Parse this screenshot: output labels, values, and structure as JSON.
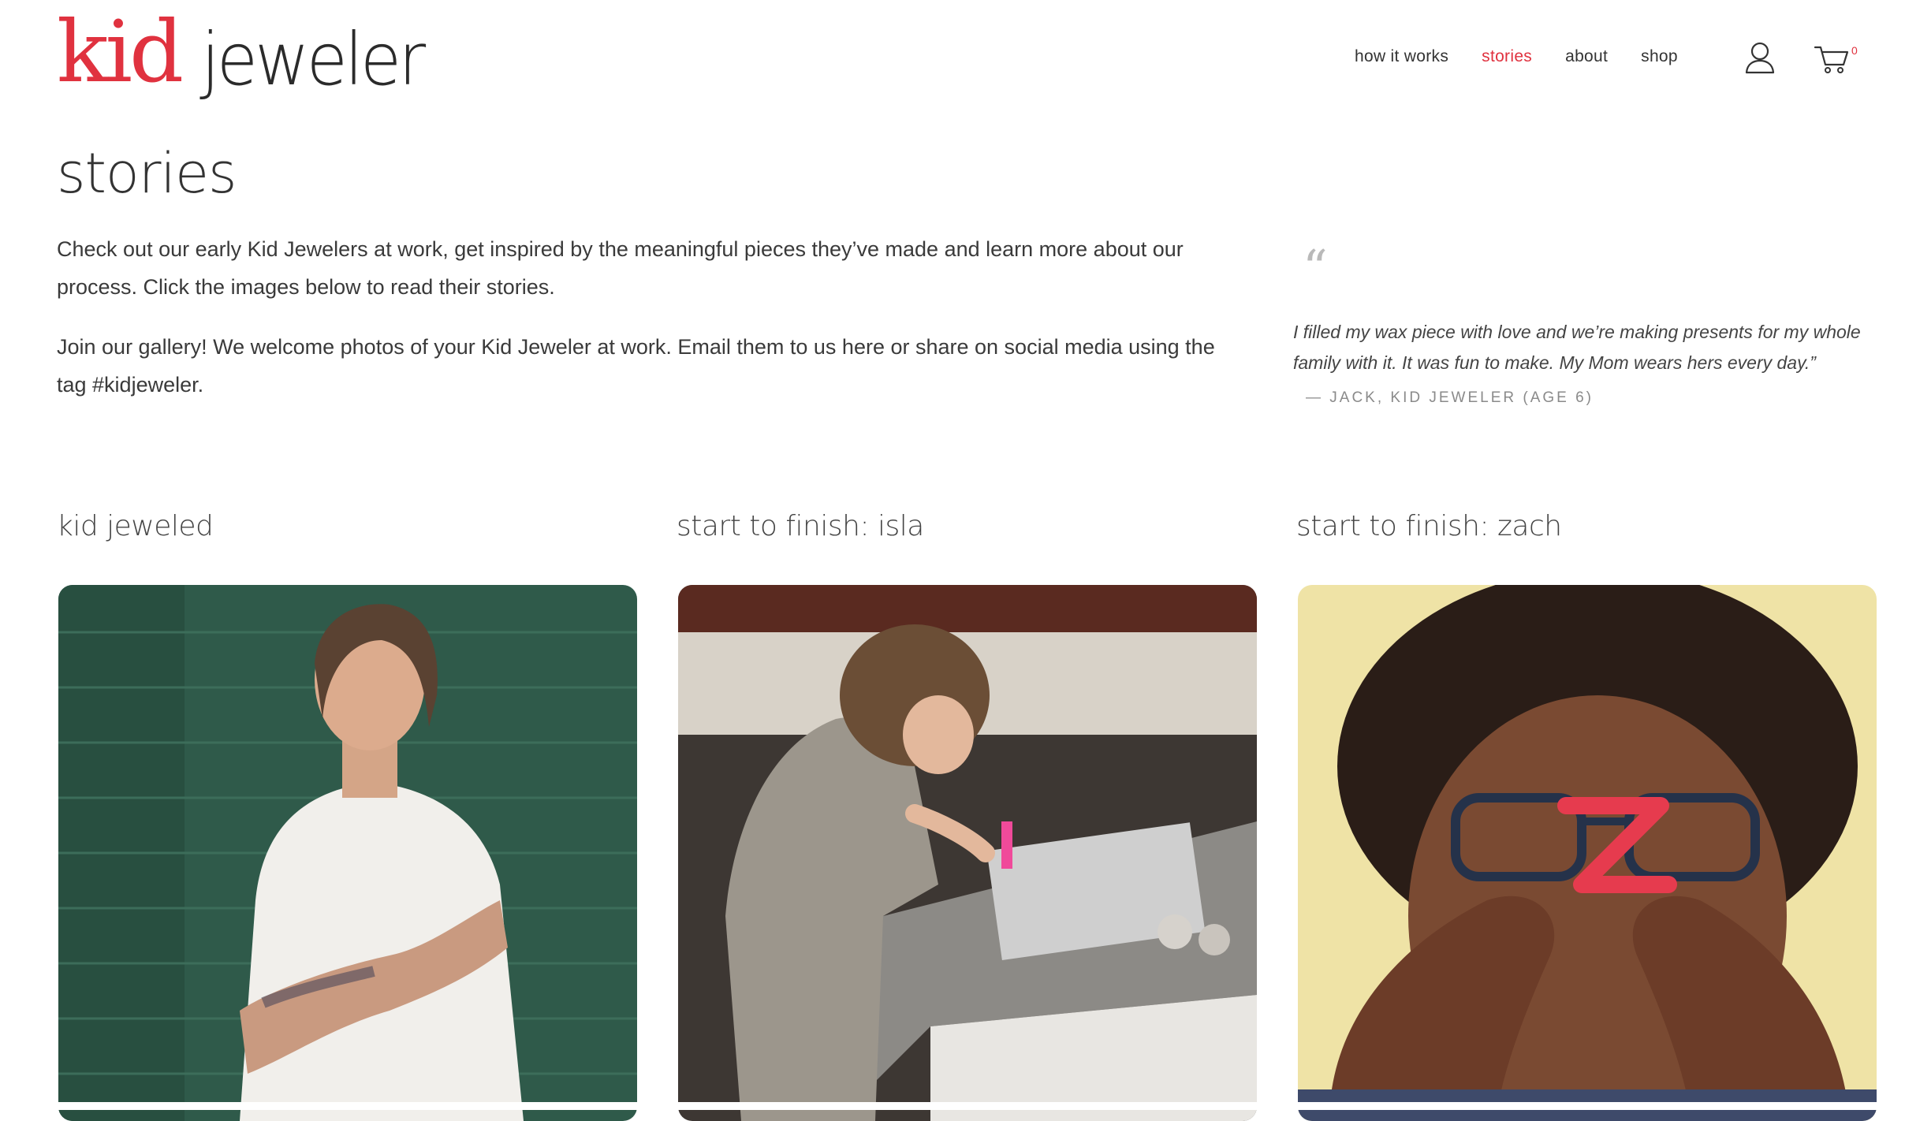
{
  "logo": {
    "part1": "kid",
    "part2": "jeweler"
  },
  "nav": {
    "items": [
      {
        "label": "how it works"
      },
      {
        "label": "stories"
      },
      {
        "label": "about"
      },
      {
        "label": "shop"
      }
    ],
    "active": "stories",
    "cart_count": "0",
    "icons": [
      "user-icon",
      "cart-icon"
    ]
  },
  "page": {
    "title": "stories",
    "intro_1": "Check out our early Kid Jewelers at work, get inspired by the meaningful pieces they’ve made and learn more about our process. Click the images below to read their stories.",
    "intro_2": "Join our gallery! We welcome photos of your Kid Jeweler at work. Email them to us here or share on social media using the tag #kidjeweler."
  },
  "quote": {
    "mark": "“",
    "text": "I filled my wax piece with love and we’re making presents for my whole family with it. It was fun to make. My Mom wears hers every day.”",
    "author": "— JACK, KID JEWELER (AGE 6)"
  },
  "stories": [
    {
      "title": "kid jeweled"
    },
    {
      "title": "start to finish: isla"
    },
    {
      "title": "start to finish: zach"
    }
  ],
  "colors": {
    "brand_red": "#e0323f",
    "text": "#333333",
    "muted": "#8a8a8a"
  }
}
